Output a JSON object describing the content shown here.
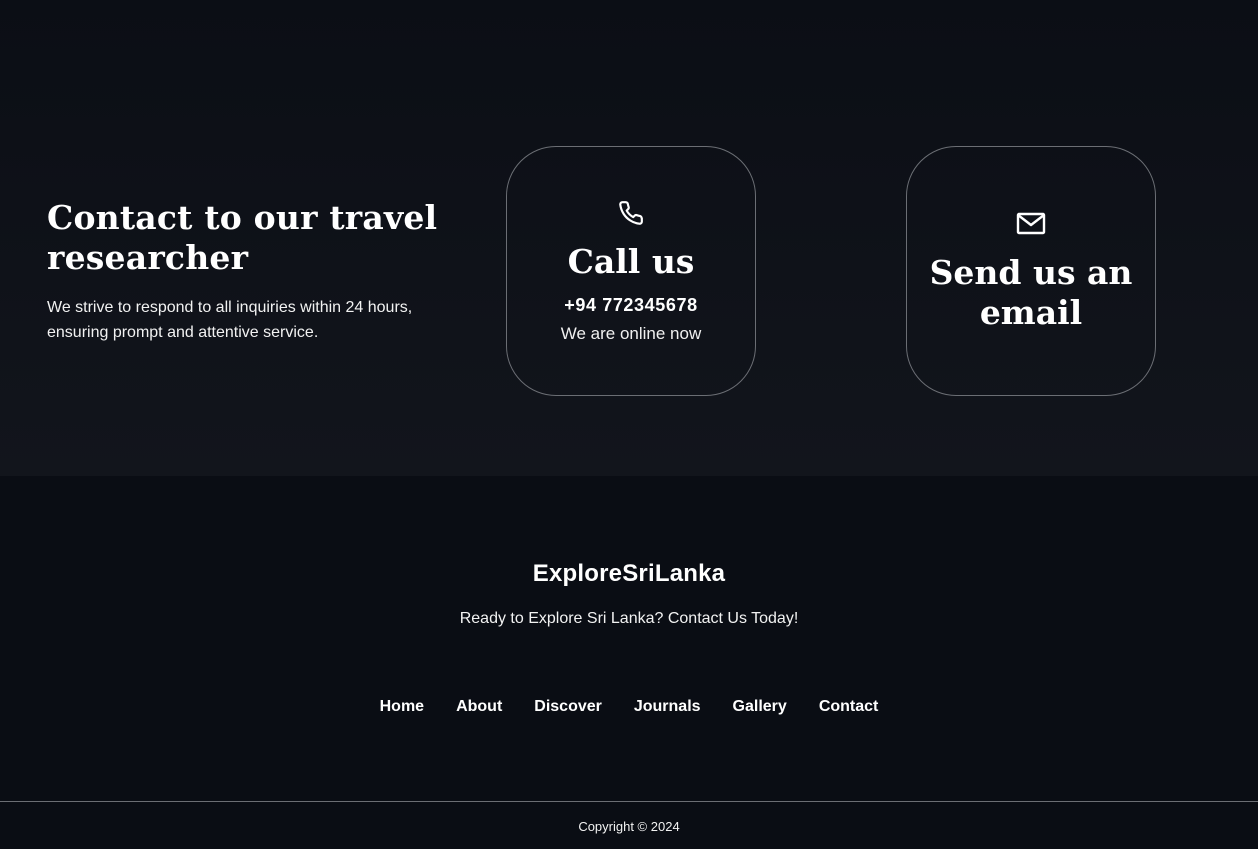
{
  "contact": {
    "heading": "Contact to our travel researcher",
    "description": "We strive to respond to all inquiries within 24 hours, ensuring prompt and attentive service.",
    "call_card": {
      "icon": "phone-icon",
      "title": "Call us",
      "phone": "+94  772345678",
      "status": "We are online now"
    },
    "email_card": {
      "icon": "mail-icon",
      "title": "Send us an email"
    }
  },
  "footer": {
    "brand": "ExploreSriLanka",
    "tagline": "Ready to Explore Sri Lanka? Contact Us Today!",
    "nav": [
      "Home",
      "About",
      "Discover",
      "Journals",
      "Gallery",
      "Contact"
    ],
    "copyright": "Copyright © 2024"
  },
  "colors": {
    "background": "#0a0d14",
    "card_border": "#6b6e74",
    "text": "#ffffff"
  }
}
